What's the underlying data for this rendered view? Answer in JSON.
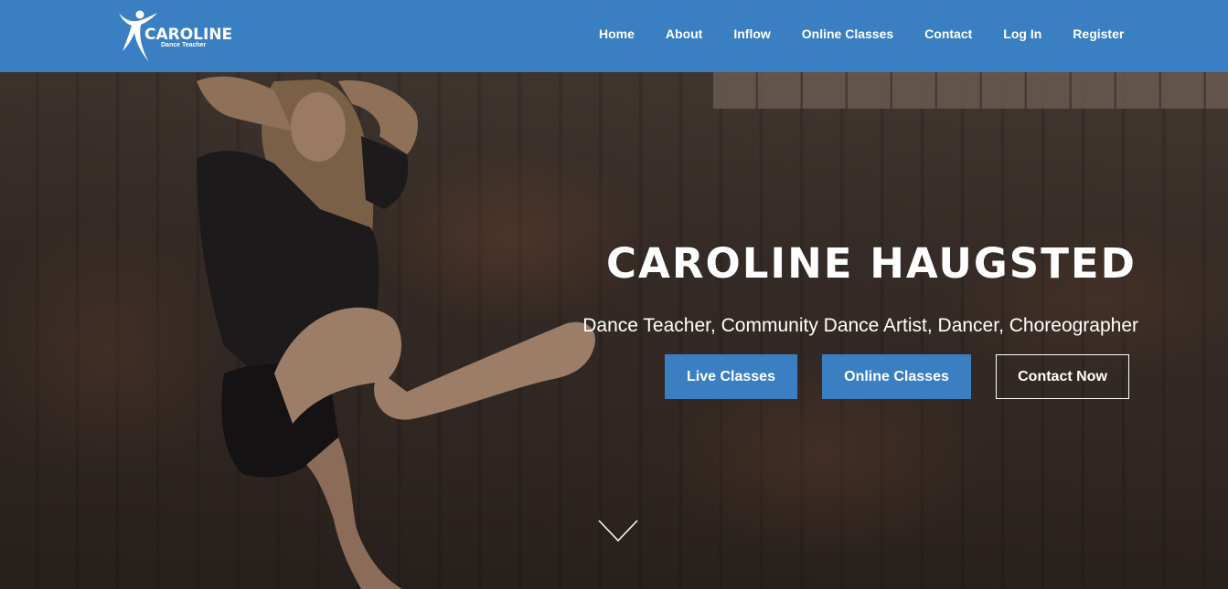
{
  "header": {
    "logo": {
      "title": "CAROLINE",
      "subtitle": "Dance Teacher"
    },
    "nav": [
      {
        "label": "Home"
      },
      {
        "label": "About"
      },
      {
        "label": "Inflow"
      },
      {
        "label": "Online Classes"
      },
      {
        "label": "Contact"
      },
      {
        "label": "Log In"
      },
      {
        "label": "Register"
      }
    ]
  },
  "hero": {
    "title": "CAROLINE HAUGSTED",
    "subtitle": "Dance Teacher, Community Dance Artist, Dancer, Choreographer",
    "buttons": [
      {
        "label": "Live Classes"
      },
      {
        "label": "Online Classes"
      },
      {
        "label": "Contact Now"
      }
    ],
    "scroll_icon": "chevron-down-icon"
  },
  "colors": {
    "header_bg": "#3a7fc1",
    "button_bg": "#3a7fc1",
    "text": "#ffffff"
  }
}
